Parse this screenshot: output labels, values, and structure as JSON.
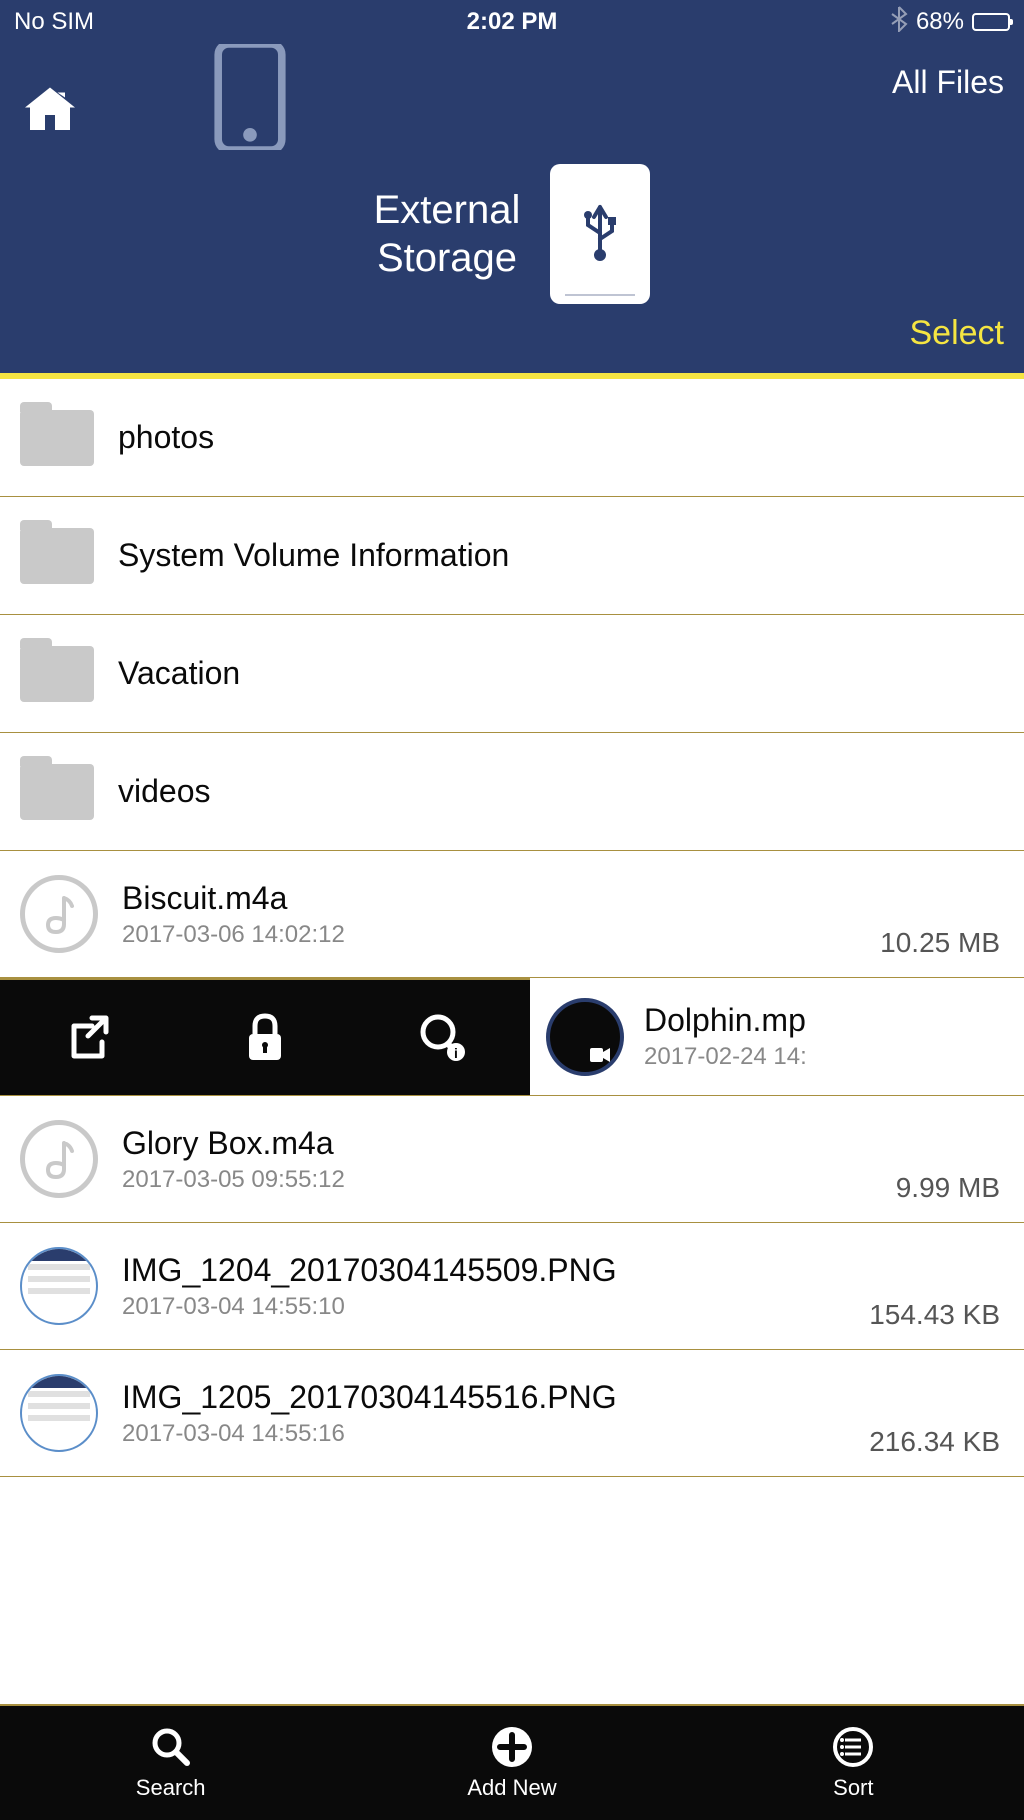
{
  "status": {
    "carrier": "No SIM",
    "time": "2:02 PM",
    "battery_pct": "68%"
  },
  "header": {
    "all_files": "All Files",
    "title_line1": "External",
    "title_line2": "Storage",
    "select": "Select"
  },
  "items": [
    {
      "type": "folder",
      "name": "photos"
    },
    {
      "type": "folder",
      "name": "System Volume Information"
    },
    {
      "type": "folder",
      "name": "Vacation"
    },
    {
      "type": "folder",
      "name": "videos"
    },
    {
      "type": "audio",
      "name": "Biscuit.m4a",
      "meta": "2017-03-06 14:02:12",
      "size": "10.25 MB"
    },
    {
      "type": "video",
      "name": "Dolphin.mp",
      "meta": "2017-02-24 14:"
    },
    {
      "type": "audio",
      "name": "Glory Box.m4a",
      "meta": "2017-03-05 09:55:12",
      "size": "9.99 MB"
    },
    {
      "type": "image",
      "name": "IMG_1204_20170304145509.PNG",
      "meta": "2017-03-04 14:55:10",
      "size": "154.43 KB"
    },
    {
      "type": "image",
      "name": "IMG_1205_20170304145516.PNG",
      "meta": "2017-03-04 14:55:16",
      "size": "216.34 KB"
    }
  ],
  "toolbar": {
    "search": "Search",
    "add_new": "Add New",
    "sort": "Sort"
  }
}
